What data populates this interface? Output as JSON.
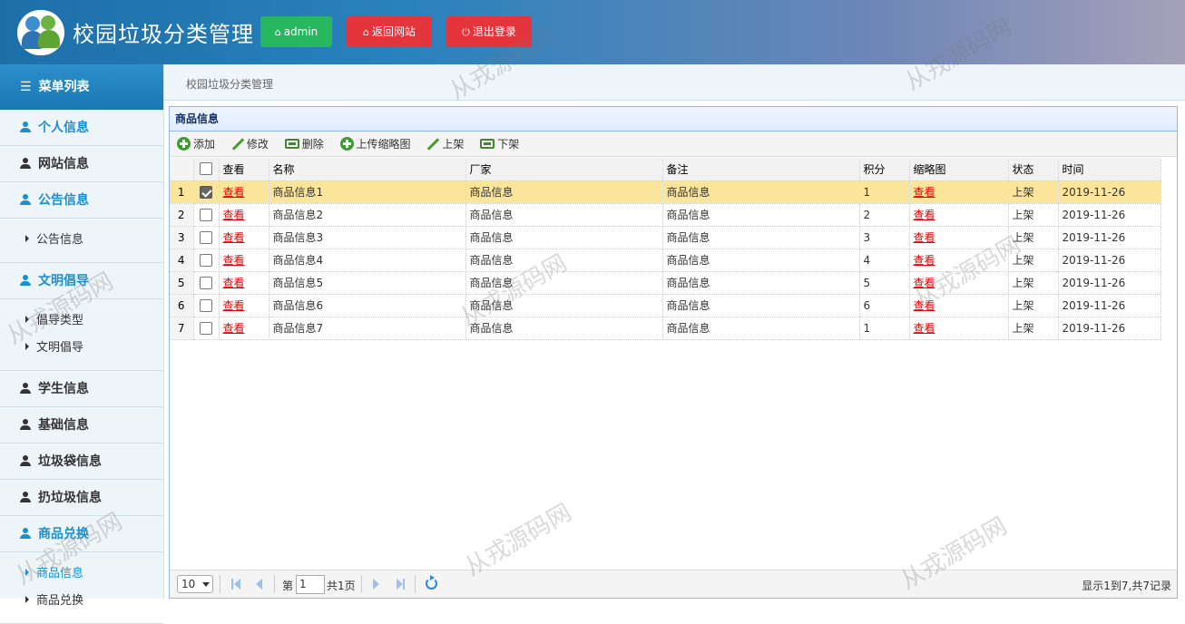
{
  "header": {
    "app_title": "校园垃圾分类管理",
    "user_button": "admin",
    "back_button": "返回网站",
    "logout_button": "退出登录"
  },
  "sidebar": {
    "title": "菜单列表",
    "groups": [
      {
        "label": "个人信息",
        "active": true,
        "items": []
      },
      {
        "label": "网站信息",
        "active": false,
        "items": []
      },
      {
        "label": "公告信息",
        "active": true,
        "items": [
          "公告信息"
        ]
      },
      {
        "label": "文明倡导",
        "active": true,
        "items": [
          "倡导类型",
          "文明倡导"
        ]
      },
      {
        "label": "学生信息",
        "active": false,
        "items": []
      },
      {
        "label": "基础信息",
        "active": false,
        "items": []
      },
      {
        "label": "垃圾袋信息",
        "active": false,
        "items": []
      },
      {
        "label": "扔垃圾信息",
        "active": false,
        "items": []
      },
      {
        "label": "商品兑换",
        "active": true,
        "items": [
          "商品信息",
          "商品兑换"
        ]
      }
    ]
  },
  "breadcrumb": "校园垃圾分类管理",
  "panel": {
    "title": "商品信息",
    "toolbar": {
      "add": "添加",
      "edit": "修改",
      "delete": "删除",
      "upload": "上传缩略图",
      "list_on": "上架",
      "list_off": "下架"
    },
    "columns": [
      "查看",
      "名称",
      "厂家",
      "备注",
      "积分",
      "缩略图",
      "状态",
      "时间"
    ],
    "rows": [
      {
        "n": "1",
        "view": "查看",
        "name": "商品信息1",
        "maker": "商品信息",
        "note": "商品信息",
        "points": "1",
        "thumb": "查看",
        "status": "上架",
        "time": "2019-11-26",
        "checked": true
      },
      {
        "n": "2",
        "view": "查看",
        "name": "商品信息2",
        "maker": "商品信息",
        "note": "商品信息",
        "points": "2",
        "thumb": "查看",
        "status": "上架",
        "time": "2019-11-26",
        "checked": false
      },
      {
        "n": "3",
        "view": "查看",
        "name": "商品信息3",
        "maker": "商品信息",
        "note": "商品信息",
        "points": "3",
        "thumb": "查看",
        "status": "上架",
        "time": "2019-11-26",
        "checked": false
      },
      {
        "n": "4",
        "view": "查看",
        "name": "商品信息4",
        "maker": "商品信息",
        "note": "商品信息",
        "points": "4",
        "thumb": "查看",
        "status": "上架",
        "time": "2019-11-26",
        "checked": false
      },
      {
        "n": "5",
        "view": "查看",
        "name": "商品信息5",
        "maker": "商品信息",
        "note": "商品信息",
        "points": "5",
        "thumb": "查看",
        "status": "上架",
        "time": "2019-11-26",
        "checked": false
      },
      {
        "n": "6",
        "view": "查看",
        "name": "商品信息6",
        "maker": "商品信息",
        "note": "商品信息",
        "points": "6",
        "thumb": "查看",
        "status": "上架",
        "time": "2019-11-26",
        "checked": false
      },
      {
        "n": "7",
        "view": "查看",
        "name": "商品信息7",
        "maker": "商品信息",
        "note": "商品信息",
        "points": "1",
        "thumb": "查看",
        "status": "上架",
        "time": "2019-11-26",
        "checked": false
      }
    ]
  },
  "pager": {
    "page_size": "10",
    "label_page": "第",
    "current_page": "1",
    "label_total": "共1页",
    "info": "显示1到7,共7记录"
  },
  "watermark": "从戎源码网"
}
